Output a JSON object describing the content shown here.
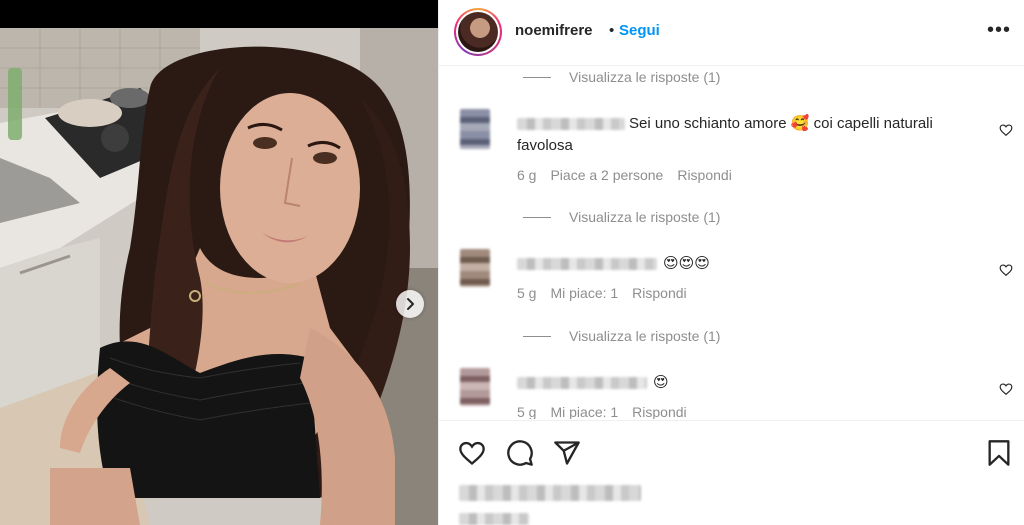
{
  "post": {
    "username": "noemifrere",
    "separator": "•",
    "follow_label": "Segui",
    "more_label": "•••"
  },
  "comments": {
    "view_replies_label": "Visualizza le risposte (1)",
    "items": [
      {
        "text": "Sei uno schianto amore 🥰 coi capelli naturali favolosa",
        "age": "6 g",
        "likes": "Piace a 2 persone",
        "reply": "Rispondi"
      },
      {
        "text": "😍😍😍",
        "age": "5 g",
        "likes": "Mi piace: 1",
        "reply": "Rispondi"
      },
      {
        "text": "😍",
        "age": "5 g",
        "likes": "Mi piace: 1",
        "reply": "Rispondi"
      }
    ]
  },
  "icons": {
    "like": "heart-icon",
    "comment": "comment-icon",
    "share": "paper-plane-icon",
    "save": "bookmark-icon",
    "next": "chevron-right-icon",
    "more": "more-horizontal-icon",
    "comment_like": "heart-icon"
  },
  "colors": {
    "link_blue": "#0095f6",
    "text": "#262626",
    "muted": "#8e8e8e",
    "border": "#efefef"
  }
}
